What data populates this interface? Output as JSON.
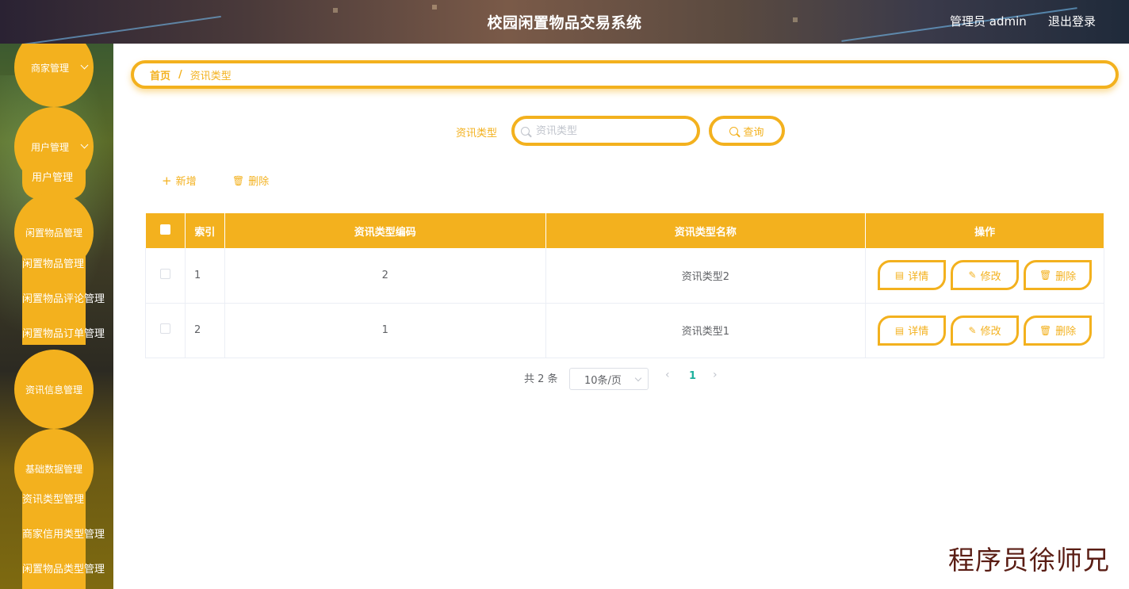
{
  "header": {
    "title": "校园闲置物品交易系统",
    "admin": "管理员 admin",
    "logout": "退出登录"
  },
  "sidebar": {
    "menus": [
      {
        "label": "商家管理",
        "subs": []
      },
      {
        "label": "用户管理",
        "subs": [
          "用户管理"
        ]
      },
      {
        "label": "闲置物品管理",
        "subs": [
          "闲置物品管理",
          "闲置物品评论管理",
          "闲置物品订单管理"
        ]
      },
      {
        "label": "资讯信息管理",
        "subs": []
      },
      {
        "label": "基础数据管理",
        "subs": [
          "资讯类型管理",
          "商家信用类型管理",
          "闲置物品类型管理"
        ]
      }
    ]
  },
  "breadcrumb": {
    "home": "首页",
    "separator": "/",
    "current": "资讯类型"
  },
  "search": {
    "label": "资讯类型",
    "placeholder": "资讯类型",
    "button": "查询"
  },
  "toolbar": {
    "add": "新增",
    "delete": "删除"
  },
  "table": {
    "headers": [
      "索引",
      "资讯类型编码",
      "资讯类型名称",
      "操作"
    ],
    "rows": [
      {
        "index": "1",
        "code": "2",
        "name": "资讯类型2"
      },
      {
        "index": "2",
        "code": "1",
        "name": "资讯类型1"
      }
    ],
    "actions": {
      "detail": "详情",
      "edit": "修改",
      "delete": "删除"
    }
  },
  "pagination": {
    "total": "共 2 条",
    "page_size": "10条/页",
    "current": "1"
  },
  "watermark": "程序员徐师兄",
  "colors": {
    "accent": "#f3b11e",
    "active_page": "#1fb19e"
  }
}
